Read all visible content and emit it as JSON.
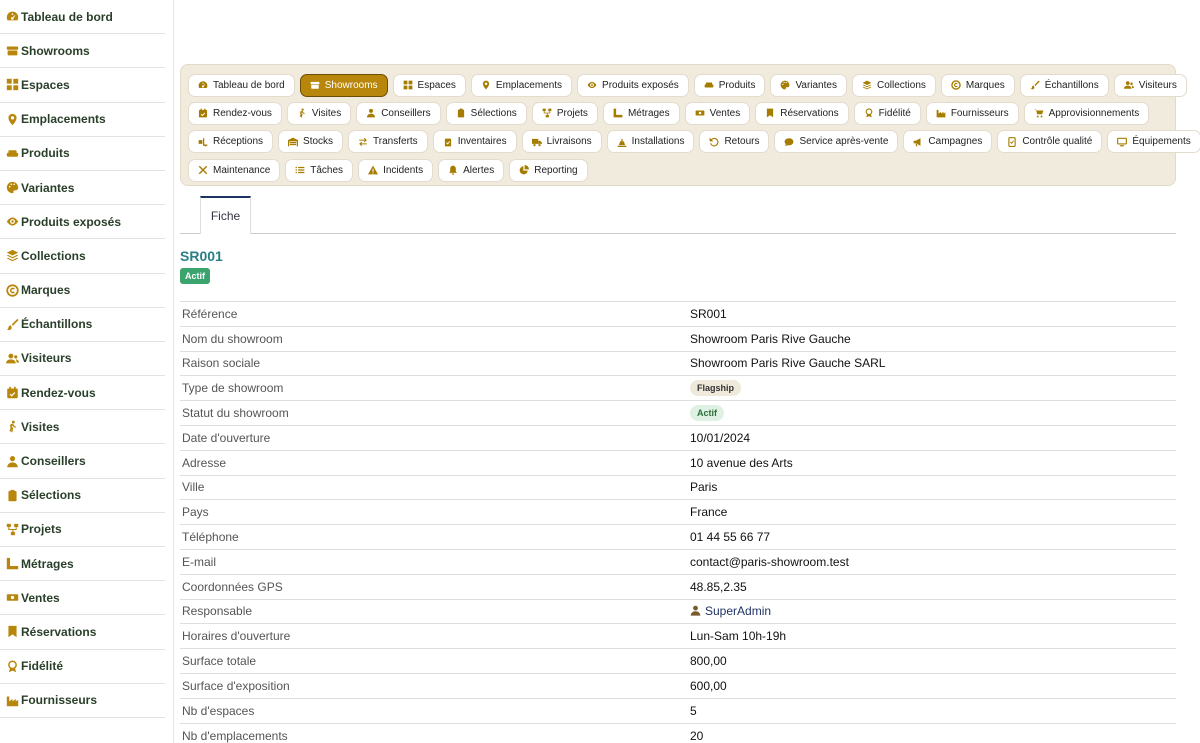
{
  "sidebar": {
    "items": [
      {
        "label": "Tableau de bord",
        "icon": "dashboard-icon"
      },
      {
        "label": "Showrooms",
        "icon": "store-icon"
      },
      {
        "label": "Espaces",
        "icon": "grid-icon"
      },
      {
        "label": "Emplacements",
        "icon": "map-pin-icon"
      },
      {
        "label": "Produits",
        "icon": "couch-icon"
      },
      {
        "label": "Variantes",
        "icon": "palette-icon"
      },
      {
        "label": "Produits exposés",
        "icon": "eye-icon"
      },
      {
        "label": "Collections",
        "icon": "layers-icon"
      },
      {
        "label": "Marques",
        "icon": "copyright-icon"
      },
      {
        "label": "Échantillons",
        "icon": "brush-icon"
      },
      {
        "label": "Visiteurs",
        "icon": "users-icon"
      },
      {
        "label": "Rendez-vous",
        "icon": "calendar-check-icon"
      },
      {
        "label": "Visites",
        "icon": "walking-icon"
      },
      {
        "label": "Conseillers",
        "icon": "user-tie-icon"
      },
      {
        "label": "Sélections",
        "icon": "clipboard-icon"
      },
      {
        "label": "Projets",
        "icon": "diagram-icon"
      },
      {
        "label": "Métrages",
        "icon": "ruler-icon"
      },
      {
        "label": "Ventes",
        "icon": "cash-icon"
      },
      {
        "label": "Réservations",
        "icon": "bookmark-icon"
      },
      {
        "label": "Fidélité",
        "icon": "award-icon"
      },
      {
        "label": "Fournisseurs",
        "icon": "industry-icon"
      }
    ]
  },
  "nav": {
    "rows": [
      [
        {
          "label": "Tableau de bord",
          "icon": "dashboard-icon",
          "active": false
        },
        {
          "label": "Showrooms",
          "icon": "store-icon",
          "active": true
        },
        {
          "label": "Espaces",
          "icon": "grid-icon",
          "active": false
        },
        {
          "label": "Emplacements",
          "icon": "map-pin-icon",
          "active": false
        },
        {
          "label": "Produits exposés",
          "icon": "eye-icon",
          "active": false
        },
        {
          "label": "Produits",
          "icon": "couch-icon",
          "active": false
        },
        {
          "label": "Variantes",
          "icon": "palette-icon",
          "active": false
        },
        {
          "label": "Collections",
          "icon": "layers-icon",
          "active": false
        },
        {
          "label": "Marques",
          "icon": "copyright-icon",
          "active": false
        },
        {
          "label": "Échantillons",
          "icon": "brush-icon",
          "active": false
        },
        {
          "label": "Visiteurs",
          "icon": "users-icon",
          "active": false
        }
      ],
      [
        {
          "label": "Rendez-vous",
          "icon": "calendar-check-icon",
          "active": false
        },
        {
          "label": "Visites",
          "icon": "walking-icon",
          "active": false
        },
        {
          "label": "Conseillers",
          "icon": "user-tie-icon",
          "active": false
        },
        {
          "label": "Sélections",
          "icon": "clipboard-icon",
          "active": false
        },
        {
          "label": "Projets",
          "icon": "diagram-icon",
          "active": false
        },
        {
          "label": "Métrages",
          "icon": "ruler-icon",
          "active": false
        },
        {
          "label": "Ventes",
          "icon": "cash-icon",
          "active": false
        },
        {
          "label": "Réservations",
          "icon": "bookmark-icon",
          "active": false
        },
        {
          "label": "Fidélité",
          "icon": "award-icon",
          "active": false
        },
        {
          "label": "Fournisseurs",
          "icon": "industry-icon",
          "active": false
        },
        {
          "label": "Approvisionnements",
          "icon": "cart-icon",
          "active": false
        }
      ],
      [
        {
          "label": "Réceptions",
          "icon": "truck-loading-icon",
          "active": false
        },
        {
          "label": "Stocks",
          "icon": "warehouse-icon",
          "active": false
        },
        {
          "label": "Transferts",
          "icon": "exchange-icon",
          "active": false
        },
        {
          "label": "Inventaires",
          "icon": "clipboard-check-icon",
          "active": false
        },
        {
          "label": "Livraisons",
          "icon": "truck-icon",
          "active": false
        },
        {
          "label": "Installations",
          "icon": "tools-icon",
          "active": false
        },
        {
          "label": "Retours",
          "icon": "undo-icon",
          "active": false
        },
        {
          "label": "Service après-vente",
          "icon": "comment-icon",
          "active": false
        },
        {
          "label": "Campagnes",
          "icon": "megaphone-icon",
          "active": false
        },
        {
          "label": "Contrôle qualité",
          "icon": "checklist-icon",
          "active": false
        },
        {
          "label": "Équipements",
          "icon": "monitor-icon",
          "active": false
        }
      ],
      [
        {
          "label": "Maintenance",
          "icon": "wrench-icon",
          "active": false
        },
        {
          "label": "Tâches",
          "icon": "tasks-icon",
          "active": false
        },
        {
          "label": "Incidents",
          "icon": "warning-icon",
          "active": false
        },
        {
          "label": "Alertes",
          "icon": "bell-icon",
          "active": false
        },
        {
          "label": "Reporting",
          "icon": "pie-chart-icon",
          "active": false
        }
      ]
    ]
  },
  "tabs": {
    "fiche": "Fiche"
  },
  "record": {
    "reference": "SR001",
    "status_badge": "Actif"
  },
  "fields": [
    {
      "key": "Référence",
      "value": "SR001"
    },
    {
      "key": "Nom du showroom",
      "value": "Showroom Paris Rive Gauche"
    },
    {
      "key": "Raison sociale",
      "value": "Showroom Paris Rive Gauche SARL"
    },
    {
      "key": "Type de showroom",
      "value": "Flagship",
      "chip": "neutral"
    },
    {
      "key": "Statut du showroom",
      "value": "Actif",
      "chip": "green"
    },
    {
      "key": "Date d'ouverture",
      "value": "10/01/2024"
    },
    {
      "key": "Adresse",
      "value": "10 avenue des Arts"
    },
    {
      "key": "Ville",
      "value": "Paris"
    },
    {
      "key": "Pays",
      "value": "France"
    },
    {
      "key": "Téléphone",
      "value": "01 44 55 66 77"
    },
    {
      "key": "E-mail",
      "value": "contact@paris-showroom.test"
    },
    {
      "key": "Coordonnées GPS",
      "value": "48.85,2.35"
    },
    {
      "key": "Responsable",
      "value": "SuperAdmin",
      "link": true
    },
    {
      "key": "Horaires d'ouverture",
      "value": "Lun-Sam 10h-19h"
    },
    {
      "key": "Surface totale",
      "value": "800,00"
    },
    {
      "key": "Surface d'exposition",
      "value": "600,00"
    },
    {
      "key": "Nb d'espaces",
      "value": "5"
    },
    {
      "key": "Nb d'emplacements",
      "value": "20"
    }
  ],
  "colors": {
    "accent": "#b8860b",
    "title": "#2a7f86",
    "badge": "#3aa36e",
    "link": "#1e3264"
  }
}
